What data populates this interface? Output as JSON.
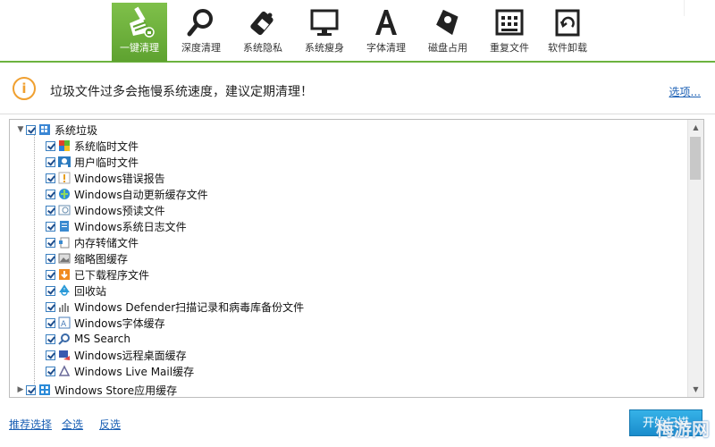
{
  "toolbar": {
    "tabs": [
      {
        "label": "一键清理",
        "icon": "broom-icon",
        "active": true
      },
      {
        "label": "深度清理",
        "icon": "magnifier-icon"
      },
      {
        "label": "系统隐私",
        "icon": "eraser-icon"
      },
      {
        "label": "系统瘦身",
        "icon": "monitor-icon"
      },
      {
        "label": "字体清理",
        "icon": "font-a-icon"
      },
      {
        "label": "磁盘占用",
        "icon": "disk-tag-icon"
      },
      {
        "label": "重复文件",
        "icon": "grid-icon"
      },
      {
        "label": "软件卸载",
        "icon": "recycle-bin-icon"
      }
    ],
    "accent": "#6cb33f"
  },
  "notice": {
    "message": "垃圾文件过多会拖慢系统速度，建议定期清理！",
    "options_link": "选项..."
  },
  "tree": {
    "root": {
      "label": "系统垃圾",
      "checked": true,
      "expanded": true
    },
    "children": [
      {
        "label": "系统临时文件",
        "icon": "windows-flag-icon",
        "checked": true
      },
      {
        "label": "用户临时文件",
        "icon": "user-icon",
        "checked": true
      },
      {
        "label": "Windows错误报告",
        "icon": "warning-icon",
        "checked": true
      },
      {
        "label": "Windows自动更新缓存文件",
        "icon": "globe-update-icon",
        "checked": true
      },
      {
        "label": "Windows预读文件",
        "icon": "window-icon",
        "checked": true
      },
      {
        "label": "Windows系统日志文件",
        "icon": "log-icon",
        "checked": true
      },
      {
        "label": "内存转储文件",
        "icon": "dump-icon",
        "checked": true
      },
      {
        "label": "缩略图缓存",
        "icon": "image-icon",
        "checked": true
      },
      {
        "label": "已下载程序文件",
        "icon": "download-icon",
        "checked": true
      },
      {
        "label": "回收站",
        "icon": "recycle-icon",
        "checked": true
      },
      {
        "label": "Windows Defender扫描记录和病毒库备份文件",
        "icon": "chart-icon",
        "checked": true
      },
      {
        "label": "Windows字体缓存",
        "icon": "font-icon",
        "checked": true
      },
      {
        "label": "MS Search",
        "icon": "search-icon",
        "checked": true
      },
      {
        "label": "Windows远程桌面缓存",
        "icon": "remote-desktop-icon",
        "checked": true
      },
      {
        "label": "Windows Live Mail缓存",
        "icon": "mail-icon",
        "checked": true
      }
    ],
    "second_root": {
      "label": "Windows Store应用缓存",
      "checked": true,
      "expanded": false
    }
  },
  "footer": {
    "recommend": "推荐选择",
    "select_all": "全选",
    "invert": "反选",
    "scan_button": "开始扫描",
    "watermark": "梅游网"
  }
}
